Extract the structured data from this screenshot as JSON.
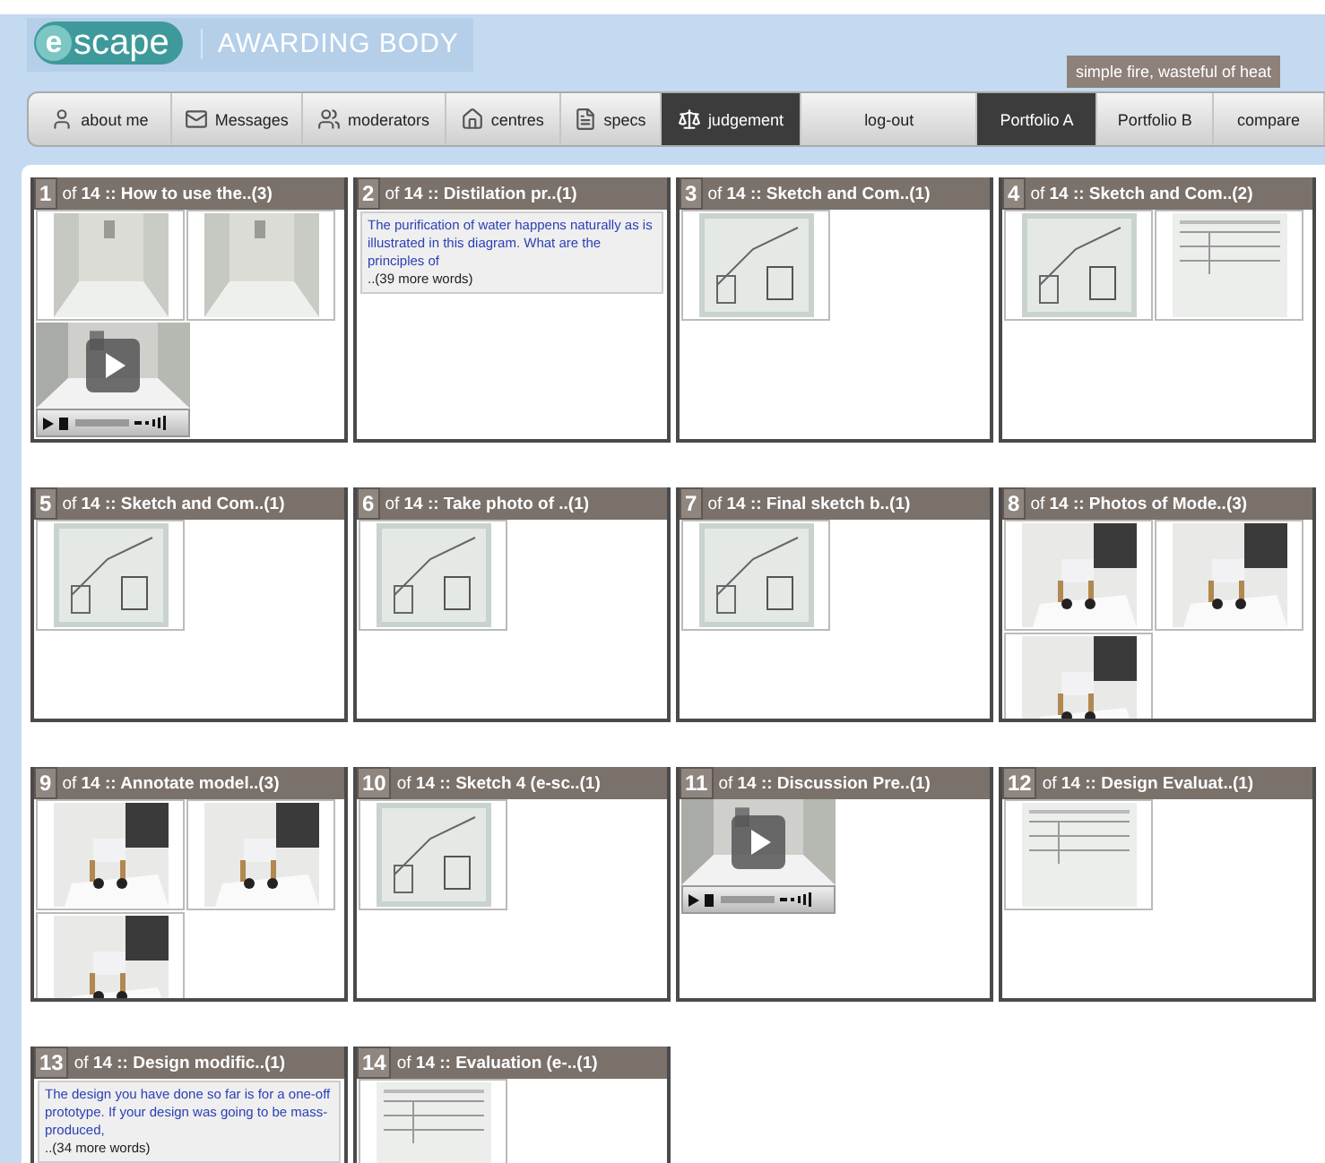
{
  "header": {
    "logo_mark": "e",
    "logo_name": "scape",
    "subtitle": "AWARDING BODY",
    "tooltip": "simple fire, wasteful of heat"
  },
  "nav": [
    {
      "label": "about me",
      "selected": false
    },
    {
      "label": "Messages",
      "selected": false
    },
    {
      "label": "moderators",
      "selected": false
    },
    {
      "label": "centres",
      "selected": false
    },
    {
      "label": "specs",
      "selected": false
    },
    {
      "label": "judgement",
      "selected": true
    },
    {
      "label": "log-out",
      "selected": false
    },
    {
      "label": "Portfolio A",
      "selected": true
    },
    {
      "label": "Portfolio B",
      "selected": false
    },
    {
      "label": "compare",
      "selected": false
    }
  ],
  "cards": [
    {
      "number": "1",
      "title": "of **14 :: How to use the..(3)**",
      "items": [
        {
          "kind": "picture"
        },
        {
          "kind": "picture"
        },
        {
          "kind": "video"
        }
      ]
    },
    {
      "number": "2",
      "title": "of **14 :: Distilation pr..(1)**",
      "items": [
        {
          "kind": "text",
          "text": "The purification of water happens naturally as is illustrated in this diagram. What are the principles of",
          "more": "..(39 more words)"
        }
      ]
    },
    {
      "number": "3",
      "title": "of **14 :: Sketch and Com..(1)**",
      "items": [
        {
          "kind": "picture"
        }
      ]
    },
    {
      "number": "4",
      "title": "of **14 :: Sketch and Com..(2)**",
      "items": [
        {
          "kind": "picture"
        },
        {
          "kind": "picture"
        }
      ]
    },
    {
      "number": "5",
      "title": "of **14 :: Sketch and Com..(1)**",
      "items": [
        {
          "kind": "picture"
        }
      ]
    },
    {
      "number": "6",
      "title": "of **14 :: Take photo of ..(1)**",
      "items": [
        {
          "kind": "picture"
        }
      ]
    },
    {
      "number": "7",
      "title": "of **14 :: Final sketch b..(1)**",
      "items": [
        {
          "kind": "picture"
        }
      ]
    },
    {
      "number": "8",
      "title": "of **14 :: Photos of Mode..(3)**",
      "items": [
        {
          "kind": "picture"
        },
        {
          "kind": "picture"
        },
        {
          "kind": "picture"
        }
      ]
    },
    {
      "number": "9",
      "title": "of **14 :: Annotate model..(3)**",
      "items": [
        {
          "kind": "picture"
        },
        {
          "kind": "picture"
        },
        {
          "kind": "picture"
        }
      ]
    },
    {
      "number": "10",
      "title": "of **14 :: Sketch 4 (e-sc..(1)**",
      "items": [
        {
          "kind": "picture"
        }
      ]
    },
    {
      "number": "11",
      "title": "of **14 :: Discussion Pre..(1)**",
      "items": [
        {
          "kind": "video"
        }
      ]
    },
    {
      "number": "12",
      "title": "of **14 :: Design Evaluat..(1)**",
      "items": [
        {
          "kind": "picture"
        }
      ]
    },
    {
      "number": "13",
      "title": "of **14 :: Design modific..(1)**",
      "items": [
        {
          "kind": "text",
          "text": "The design you have done so far is for a one-off prototype. If your design was going to be mass-produced,",
          "more": "..(34 more words)"
        }
      ]
    },
    {
      "number": "14",
      "title": "of **14 :: Evaluation (e-..(1)**",
      "items": [
        {
          "kind": "picture"
        }
      ]
    }
  ]
}
